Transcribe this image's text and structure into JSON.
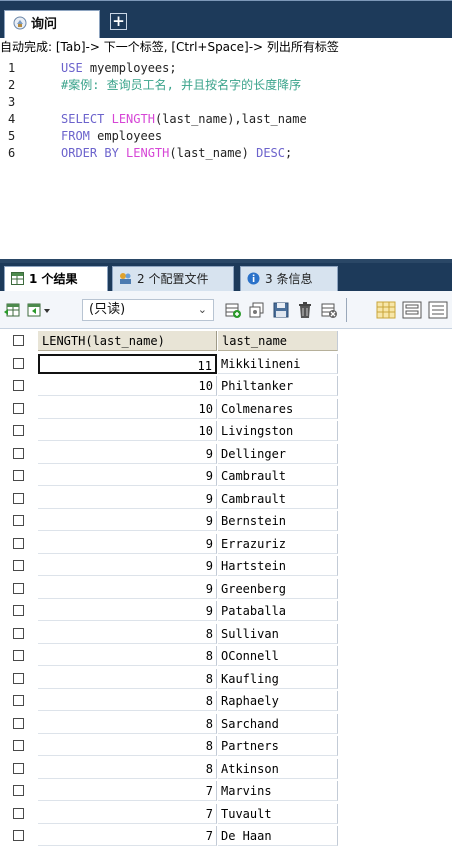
{
  "query_tab": {
    "label": "询问",
    "add_label": "+"
  },
  "hint": "自动完成: [Tab]-> 下一个标签, [Ctrl+Space]-> 列出所有标签",
  "editor": {
    "lines": [
      {
        "num": "1",
        "parts": [
          {
            "t": "kw",
            "v": "USE"
          },
          {
            "t": "tx",
            "v": " myemployees;"
          }
        ]
      },
      {
        "num": "2",
        "parts": [
          {
            "t": "cm",
            "v": "#案例: 查询员工名, 并且按名字的长度降序"
          }
        ]
      },
      {
        "num": "3",
        "parts": []
      },
      {
        "num": "4",
        "parts": [
          {
            "t": "kw",
            "v": "SELECT"
          },
          {
            "t": "tx",
            "v": " "
          },
          {
            "t": "fn",
            "v": "LENGTH"
          },
          {
            "t": "tx",
            "v": "(last_name),last_name"
          }
        ]
      },
      {
        "num": "5",
        "parts": [
          {
            "t": "kw",
            "v": "FROM"
          },
          {
            "t": "tx",
            "v": " employees"
          }
        ]
      },
      {
        "num": "6",
        "parts": [
          {
            "t": "kw",
            "v": "ORDER BY"
          },
          {
            "t": "tx",
            "v": " "
          },
          {
            "t": "fn",
            "v": "LENGTH"
          },
          {
            "t": "tx",
            "v": "(last_name) "
          },
          {
            "t": "kw",
            "v": "DESC"
          },
          {
            "t": "tx",
            "v": ";"
          }
        ]
      }
    ]
  },
  "result_tabs": {
    "results": "1 个结果",
    "profile": "2 个配置文件",
    "info": "3 条信息"
  },
  "toolbar": {
    "readonly_label": "(只读)"
  },
  "grid": {
    "headers": [
      "LENGTH(last_name)",
      "last_name"
    ],
    "rows": [
      [
        "11",
        "Mikkilineni"
      ],
      [
        "10",
        "Philtanker"
      ],
      [
        "10",
        "Colmenares"
      ],
      [
        "10",
        "Livingston"
      ],
      [
        "9",
        "Dellinger"
      ],
      [
        "9",
        "Cambrault"
      ],
      [
        "9",
        "Cambrault"
      ],
      [
        "9",
        "Bernstein"
      ],
      [
        "9",
        "Errazuriz"
      ],
      [
        "9",
        "Hartstein"
      ],
      [
        "9",
        "Greenberg"
      ],
      [
        "9",
        "Pataballa"
      ],
      [
        "8",
        "Sullivan"
      ],
      [
        "8",
        "OConnell"
      ],
      [
        "8",
        "Kaufling"
      ],
      [
        "8",
        "Raphaely"
      ],
      [
        "8",
        "Sarchand"
      ],
      [
        "8",
        "Partners"
      ],
      [
        "8",
        "Atkinson"
      ],
      [
        "7",
        "Marvins"
      ],
      [
        "7",
        "Tuvault"
      ],
      [
        "7",
        "De Haan"
      ]
    ]
  },
  "colors": {
    "frame": "#1d3a5a",
    "keyword": "#6c63cc",
    "function": "#d646d6",
    "comment": "#3aa38b",
    "header": "#e8e4d6"
  }
}
